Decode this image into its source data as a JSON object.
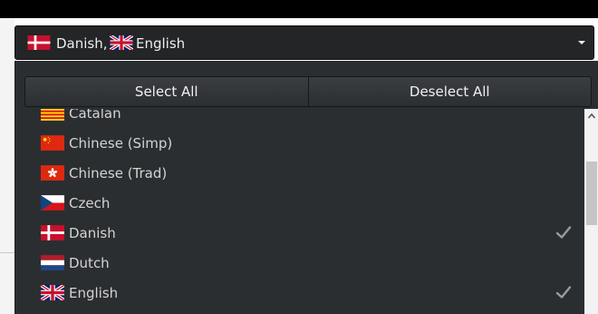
{
  "select": {
    "selected_a": "Danish,",
    "selected_b": "English",
    "caret_icon": "caret-down-icon"
  },
  "actions": {
    "select_all": "Select All",
    "deselect_all": "Deselect All"
  },
  "languages": [
    {
      "label": "Catalan",
      "flag": "catalan-flag-icon",
      "checked": false
    },
    {
      "label": "Chinese (Simp)",
      "flag": "china-flag-icon",
      "checked": false
    },
    {
      "label": "Chinese (Trad)",
      "flag": "hong-kong-flag-icon",
      "checked": false
    },
    {
      "label": "Czech",
      "flag": "czech-flag-icon",
      "checked": false
    },
    {
      "label": "Danish",
      "flag": "denmark-flag-icon",
      "checked": true
    },
    {
      "label": "Dutch",
      "flag": "netherlands-flag-icon",
      "checked": false
    },
    {
      "label": "English",
      "flag": "uk-flag-icon",
      "checked": true
    }
  ],
  "colors": {
    "panel_bg": "#2b2e31",
    "trigger_bg": "#232527",
    "item_text": "#d3d3d3",
    "check": "#9a9a9a"
  }
}
